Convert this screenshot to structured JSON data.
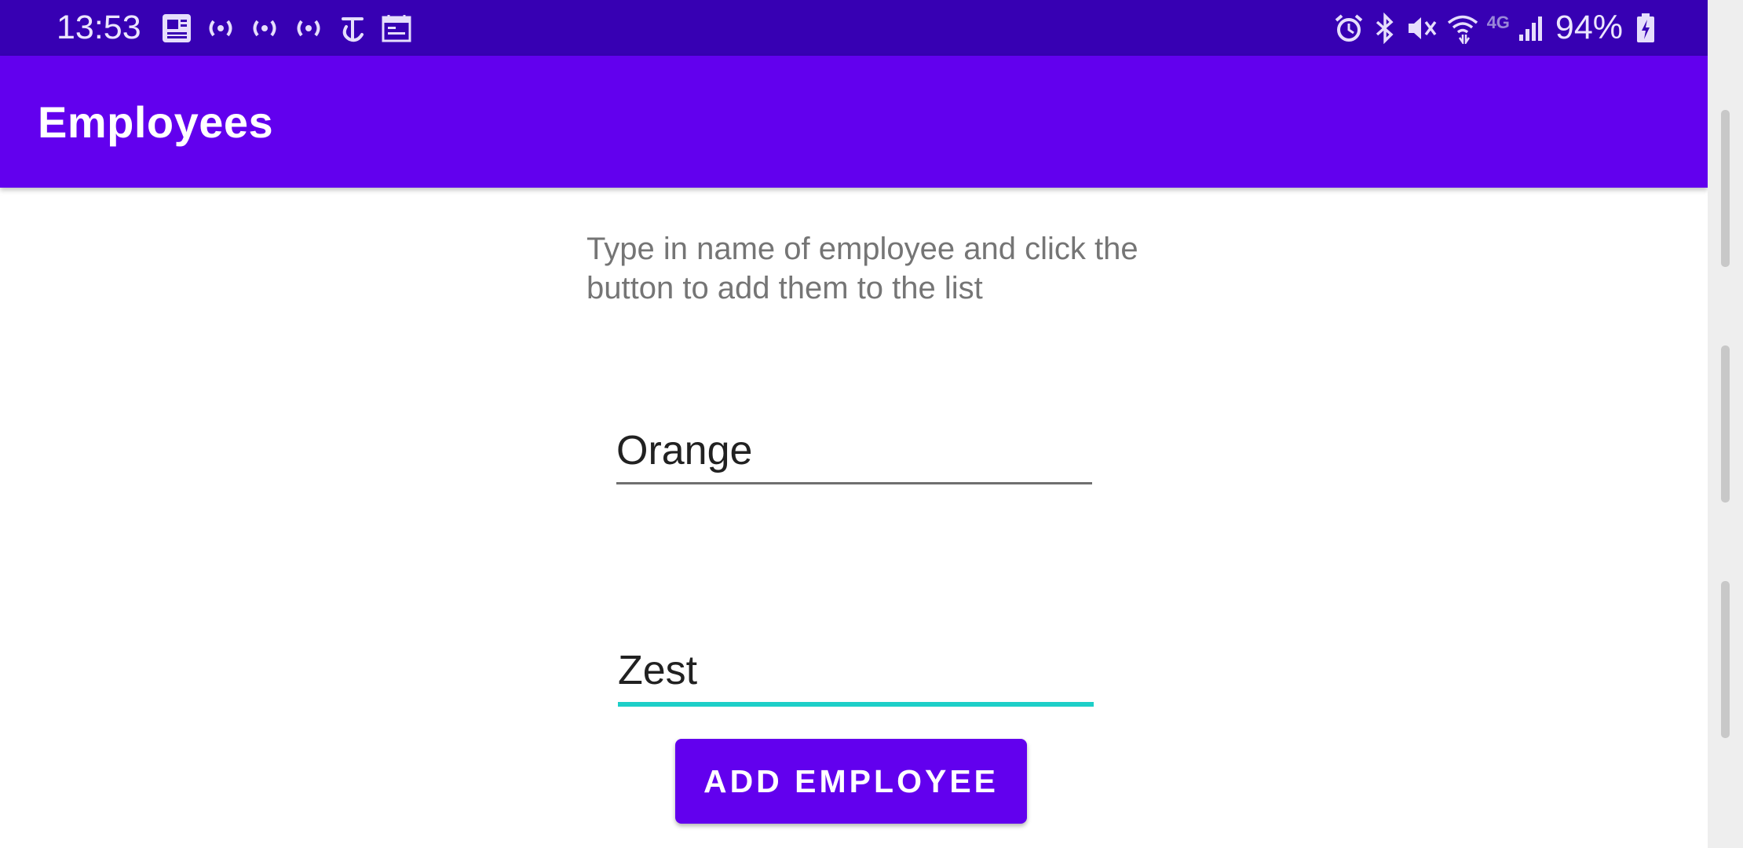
{
  "status_bar": {
    "time": "13:53",
    "left_icons": [
      "news-icon",
      "broadcast-icon",
      "broadcast-icon",
      "broadcast-icon",
      "nytimes-icon",
      "calendar-icon"
    ],
    "right_icons": [
      "alarm-icon",
      "bluetooth-icon",
      "mute-icon",
      "wifi-icon",
      "4g-lte-icon",
      "signal-icon"
    ],
    "network_label": "4G",
    "battery_percent": "94%",
    "battery_icon": "battery-charging-icon"
  },
  "app_bar": {
    "title": "Employees"
  },
  "main": {
    "instructions": "Type in name of employee and click the button to add them to the list",
    "first_name_value": "Orange",
    "last_name_value": "Zest",
    "add_button_label": "ADD EMPLOYEE"
  },
  "colors": {
    "status_bar": "#3700b3",
    "primary": "#6200ee",
    "accent": "#1dcfc8"
  }
}
